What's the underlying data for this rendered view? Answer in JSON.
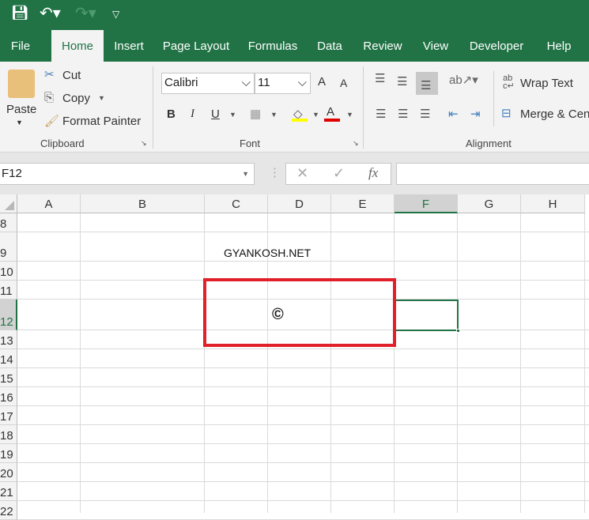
{
  "quick_access": {
    "save_icon": "save-icon",
    "undo_icon": "undo-icon",
    "redo_icon": "redo-icon",
    "customize_icon": "customize-icon"
  },
  "tabs": [
    {
      "label": "File"
    },
    {
      "label": "Home"
    },
    {
      "label": "Insert"
    },
    {
      "label": "Page Layout"
    },
    {
      "label": "Formulas"
    },
    {
      "label": "Data"
    },
    {
      "label": "Review"
    },
    {
      "label": "View"
    },
    {
      "label": "Developer"
    },
    {
      "label": "Help"
    }
  ],
  "ribbon": {
    "clipboard": {
      "paste": "Paste",
      "cut": "Cut",
      "copy": "Copy",
      "format_painter": "Format Painter",
      "label": "Clipboard"
    },
    "font": {
      "font_name": "Calibri",
      "font_size": "11",
      "bold": "B",
      "italic": "I",
      "underline": "U",
      "font_color": "A",
      "grow": "A",
      "shrink": "A",
      "label": "Font"
    },
    "alignment": {
      "wrap_text": "Wrap Text",
      "merge_center": "Merge & Cen",
      "label": "Alignment"
    }
  },
  "formula_bar": {
    "name_box": "F12",
    "cancel": "✕",
    "enter": "✓",
    "fx": "fx",
    "value": ""
  },
  "columns": [
    "A",
    "B",
    "C",
    "D",
    "E",
    "F",
    "G",
    "H"
  ],
  "rows": [
    "8",
    "9",
    "10",
    "11",
    "12",
    "13",
    "14",
    "15",
    "16",
    "17",
    "18",
    "19",
    "20",
    "21",
    "22"
  ],
  "cells": {
    "C9": "GYANKOSH.NET",
    "D12": "©"
  },
  "colors": {
    "accent": "#217346",
    "highlight_box": "#e0202a"
  }
}
